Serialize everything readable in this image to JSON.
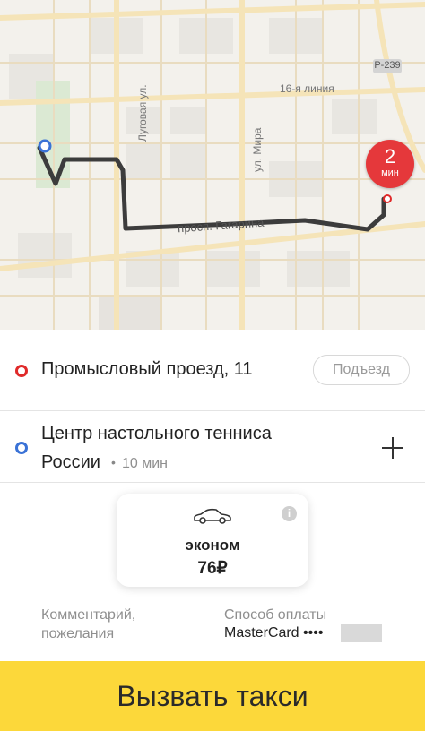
{
  "map": {
    "streets": [
      "16-я линия",
      "Луговая ул.",
      "ул. Мира",
      "просп. Гагарина"
    ],
    "highway_badge": "Р-239",
    "eta": {
      "value": "2",
      "unit": "мин"
    },
    "colors": {
      "route": "#3c3c3c",
      "pickup": "#e02a2a",
      "destination": "#3a72d6",
      "road": "#f5e4b8",
      "eta_bubble": "#e5383b"
    }
  },
  "route": {
    "pickup": {
      "address": "Промысловый проезд, 11",
      "entrance_label": "Подъезд"
    },
    "destination": {
      "address_line1": "Центр настольного тенниса",
      "address_line2": "России",
      "separator": "•",
      "duration": "10 мин",
      "add_icon": "plus-icon"
    }
  },
  "tariff": {
    "icon": "car-icon",
    "name": "эконом",
    "price": "76₽",
    "info_icon": "info-icon"
  },
  "comment": {
    "line1": "Комментарий,",
    "line2": "пожелания"
  },
  "payment": {
    "label": "Способ оплаты",
    "value": "MasterCard ••••"
  },
  "call_button": {
    "label": "Вызвать такси",
    "color": "#fcd83a"
  }
}
